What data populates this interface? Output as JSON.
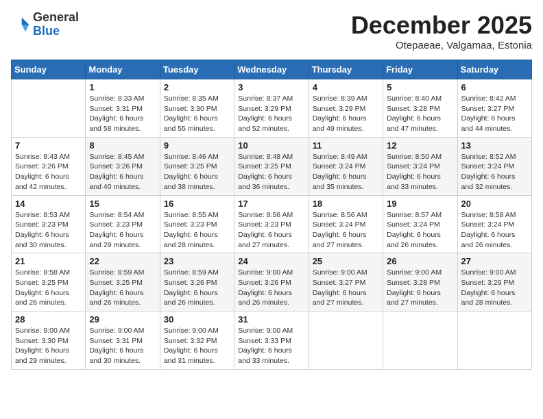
{
  "header": {
    "logo_general": "General",
    "logo_blue": "Blue",
    "month_title": "December 2025",
    "subtitle": "Otepaeae, Valgamaa, Estonia"
  },
  "weekdays": [
    "Sunday",
    "Monday",
    "Tuesday",
    "Wednesday",
    "Thursday",
    "Friday",
    "Saturday"
  ],
  "weeks": [
    [
      {
        "day": "",
        "sunrise": "",
        "sunset": "",
        "daylight": ""
      },
      {
        "day": "1",
        "sunrise": "Sunrise: 8:33 AM",
        "sunset": "Sunset: 3:31 PM",
        "daylight": "Daylight: 6 hours and 58 minutes."
      },
      {
        "day": "2",
        "sunrise": "Sunrise: 8:35 AM",
        "sunset": "Sunset: 3:30 PM",
        "daylight": "Daylight: 6 hours and 55 minutes."
      },
      {
        "day": "3",
        "sunrise": "Sunrise: 8:37 AM",
        "sunset": "Sunset: 3:29 PM",
        "daylight": "Daylight: 6 hours and 52 minutes."
      },
      {
        "day": "4",
        "sunrise": "Sunrise: 8:39 AM",
        "sunset": "Sunset: 3:29 PM",
        "daylight": "Daylight: 6 hours and 49 minutes."
      },
      {
        "day": "5",
        "sunrise": "Sunrise: 8:40 AM",
        "sunset": "Sunset: 3:28 PM",
        "daylight": "Daylight: 6 hours and 47 minutes."
      },
      {
        "day": "6",
        "sunrise": "Sunrise: 8:42 AM",
        "sunset": "Sunset: 3:27 PM",
        "daylight": "Daylight: 6 hours and 44 minutes."
      }
    ],
    [
      {
        "day": "7",
        "sunrise": "Sunrise: 8:43 AM",
        "sunset": "Sunset: 3:26 PM",
        "daylight": "Daylight: 6 hours and 42 minutes."
      },
      {
        "day": "8",
        "sunrise": "Sunrise: 8:45 AM",
        "sunset": "Sunset: 3:26 PM",
        "daylight": "Daylight: 6 hours and 40 minutes."
      },
      {
        "day": "9",
        "sunrise": "Sunrise: 8:46 AM",
        "sunset": "Sunset: 3:25 PM",
        "daylight": "Daylight: 6 hours and 38 minutes."
      },
      {
        "day": "10",
        "sunrise": "Sunrise: 8:48 AM",
        "sunset": "Sunset: 3:25 PM",
        "daylight": "Daylight: 6 hours and 36 minutes."
      },
      {
        "day": "11",
        "sunrise": "Sunrise: 8:49 AM",
        "sunset": "Sunset: 3:24 PM",
        "daylight": "Daylight: 6 hours and 35 minutes."
      },
      {
        "day": "12",
        "sunrise": "Sunrise: 8:50 AM",
        "sunset": "Sunset: 3:24 PM",
        "daylight": "Daylight: 6 hours and 33 minutes."
      },
      {
        "day": "13",
        "sunrise": "Sunrise: 8:52 AM",
        "sunset": "Sunset: 3:24 PM",
        "daylight": "Daylight: 6 hours and 32 minutes."
      }
    ],
    [
      {
        "day": "14",
        "sunrise": "Sunrise: 8:53 AM",
        "sunset": "Sunset: 3:23 PM",
        "daylight": "Daylight: 6 hours and 30 minutes."
      },
      {
        "day": "15",
        "sunrise": "Sunrise: 8:54 AM",
        "sunset": "Sunset: 3:23 PM",
        "daylight": "Daylight: 6 hours and 29 minutes."
      },
      {
        "day": "16",
        "sunrise": "Sunrise: 8:55 AM",
        "sunset": "Sunset: 3:23 PM",
        "daylight": "Daylight: 6 hours and 28 minutes."
      },
      {
        "day": "17",
        "sunrise": "Sunrise: 8:56 AM",
        "sunset": "Sunset: 3:23 PM",
        "daylight": "Daylight: 6 hours and 27 minutes."
      },
      {
        "day": "18",
        "sunrise": "Sunrise: 8:56 AM",
        "sunset": "Sunset: 3:24 PM",
        "daylight": "Daylight: 6 hours and 27 minutes."
      },
      {
        "day": "19",
        "sunrise": "Sunrise: 8:57 AM",
        "sunset": "Sunset: 3:24 PM",
        "daylight": "Daylight: 6 hours and 26 minutes."
      },
      {
        "day": "20",
        "sunrise": "Sunrise: 8:58 AM",
        "sunset": "Sunset: 3:24 PM",
        "daylight": "Daylight: 6 hours and 26 minutes."
      }
    ],
    [
      {
        "day": "21",
        "sunrise": "Sunrise: 8:58 AM",
        "sunset": "Sunset: 3:25 PM",
        "daylight": "Daylight: 6 hours and 26 minutes."
      },
      {
        "day": "22",
        "sunrise": "Sunrise: 8:59 AM",
        "sunset": "Sunset: 3:25 PM",
        "daylight": "Daylight: 6 hours and 26 minutes."
      },
      {
        "day": "23",
        "sunrise": "Sunrise: 8:59 AM",
        "sunset": "Sunset: 3:26 PM",
        "daylight": "Daylight: 6 hours and 26 minutes."
      },
      {
        "day": "24",
        "sunrise": "Sunrise: 9:00 AM",
        "sunset": "Sunset: 3:26 PM",
        "daylight": "Daylight: 6 hours and 26 minutes."
      },
      {
        "day": "25",
        "sunrise": "Sunrise: 9:00 AM",
        "sunset": "Sunset: 3:27 PM",
        "daylight": "Daylight: 6 hours and 27 minutes."
      },
      {
        "day": "26",
        "sunrise": "Sunrise: 9:00 AM",
        "sunset": "Sunset: 3:28 PM",
        "daylight": "Daylight: 6 hours and 27 minutes."
      },
      {
        "day": "27",
        "sunrise": "Sunrise: 9:00 AM",
        "sunset": "Sunset: 3:29 PM",
        "daylight": "Daylight: 6 hours and 28 minutes."
      }
    ],
    [
      {
        "day": "28",
        "sunrise": "Sunrise: 9:00 AM",
        "sunset": "Sunset: 3:30 PM",
        "daylight": "Daylight: 6 hours and 29 minutes."
      },
      {
        "day": "29",
        "sunrise": "Sunrise: 9:00 AM",
        "sunset": "Sunset: 3:31 PM",
        "daylight": "Daylight: 6 hours and 30 minutes."
      },
      {
        "day": "30",
        "sunrise": "Sunrise: 9:00 AM",
        "sunset": "Sunset: 3:32 PM",
        "daylight": "Daylight: 6 hours and 31 minutes."
      },
      {
        "day": "31",
        "sunrise": "Sunrise: 9:00 AM",
        "sunset": "Sunset: 3:33 PM",
        "daylight": "Daylight: 6 hours and 33 minutes."
      },
      {
        "day": "",
        "sunrise": "",
        "sunset": "",
        "daylight": ""
      },
      {
        "day": "",
        "sunrise": "",
        "sunset": "",
        "daylight": ""
      },
      {
        "day": "",
        "sunrise": "",
        "sunset": "",
        "daylight": ""
      }
    ]
  ]
}
